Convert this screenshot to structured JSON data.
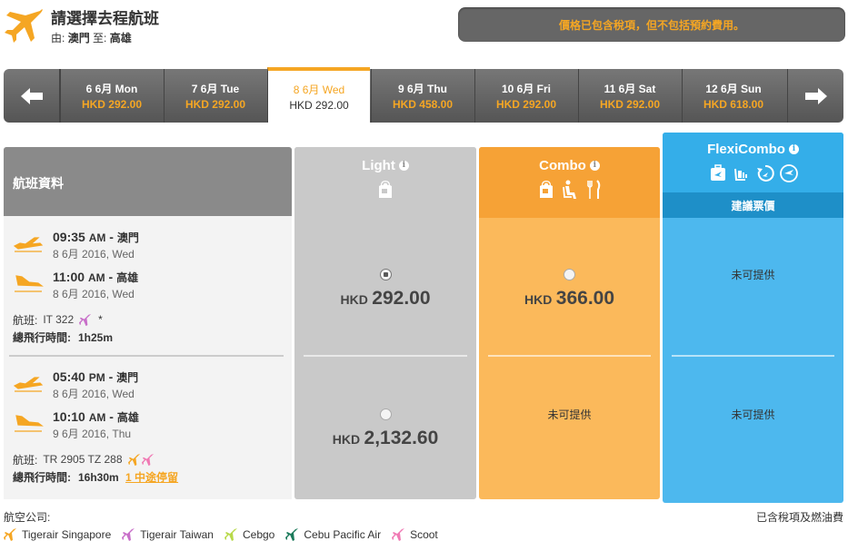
{
  "header": {
    "title": "請選擇去程航班",
    "from_label": "由:",
    "from": "澳門",
    "to_label": "至:",
    "to": "高雄",
    "notice": "價格已包含稅項，但不包括預約費用。"
  },
  "dates": [
    {
      "date": "6 6月 Mon",
      "price": "HKD 292.00"
    },
    {
      "date": "7 6月 Tue",
      "price": "HKD 292.00"
    },
    {
      "date": "8 6月 Wed",
      "price": "HKD 292.00",
      "selected": true
    },
    {
      "date": "9 6月 Thu",
      "price": "HKD 458.00"
    },
    {
      "date": "10 6月 Fri",
      "price": "HKD 292.00"
    },
    {
      "date": "11 6月 Sat",
      "price": "HKD 292.00"
    },
    {
      "date": "12 6月 Sun",
      "price": "HKD 618.00"
    }
  ],
  "table": {
    "info_header": "航班資料",
    "light": "Light",
    "combo": "Combo",
    "flexi": "FlexiCombo",
    "recommend": "建議票價",
    "info_icon": "i"
  },
  "flights": [
    {
      "dep_time": "09:35",
      "dep_ampm": "AM",
      "dep_city": "澳門",
      "dep_date": "8 6月 2016, Wed",
      "arr_time": "11:00",
      "arr_ampm": "AM",
      "arr_city": "高雄",
      "arr_date": "8 6月 2016, Wed",
      "flight_label": "航班:",
      "flight_no": "IT 322",
      "flight_note": "*",
      "duration_label": "總飛行時間:",
      "duration": "1h25m",
      "stops": "",
      "light_currency": "HKD",
      "light_amount": "292.00",
      "light_selected": true,
      "combo_currency": "HKD",
      "combo_amount": "366.00",
      "flexi": "未可提供"
    },
    {
      "dep_time": "05:40",
      "dep_ampm": "PM",
      "dep_city": "澳門",
      "dep_date": "8 6月 2016, Wed",
      "arr_time": "10:10",
      "arr_ampm": "AM",
      "arr_city": "高雄",
      "arr_date": "9 6月 2016, Thu",
      "flight_label": "航班:",
      "flight_no": "TR 2905 TZ 288",
      "flight_note": "",
      "duration_label": "總飛行時間:",
      "duration": "16h30m",
      "stops": "1 中途停留",
      "light_currency": "HKD",
      "light_amount": "2,132.60",
      "light_selected": false,
      "combo": "未可提供",
      "flexi": "未可提供"
    }
  ],
  "footer": {
    "airlines_label": "航空公司:",
    "tax_note": "已含稅項及燃油費",
    "airlines": [
      {
        "name": "Tigerair Singapore",
        "color": "#f5a623"
      },
      {
        "name": "Tigerair Taiwan",
        "color": "#c86fc9"
      },
      {
        "name": "Cebgo",
        "color": "#b8d94a"
      },
      {
        "name": "Cebu Pacific Air",
        "color": "#1a7a5a"
      },
      {
        "name": "Scoot",
        "color": "#f07ab4"
      }
    ]
  },
  "colors": {
    "accent": "#f5a623",
    "light": "#c9c9c9",
    "combo": "#f6a236",
    "flexi": "#34aee9"
  }
}
